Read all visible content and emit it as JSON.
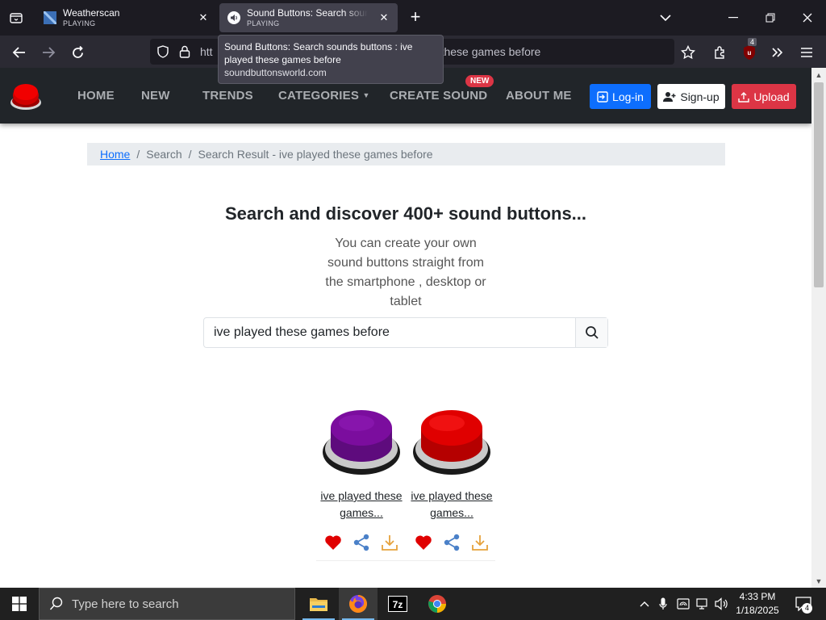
{
  "browser": {
    "tabs": [
      {
        "title": "Weatherscan",
        "status": "PLAYING"
      },
      {
        "title": "Sound Buttons: Search sounds buttons : ive played these games before",
        "status": "PLAYING"
      }
    ],
    "url_visible_start": "htt",
    "url_visible_end": "these games before",
    "extension_badge": "4",
    "tooltip": {
      "title": "Sound Buttons: Search sounds buttons : ive played these games before",
      "host": "soundbuttonsworld.com"
    }
  },
  "site": {
    "nav": [
      "HOME",
      "NEW",
      "TRENDS",
      "CATEGORIES",
      "CREATE SOUND",
      "ABOUT ME"
    ],
    "new_badge": "NEW",
    "login": "Log-in",
    "signup": "Sign-up",
    "upload": "Upload"
  },
  "breadcrumb": {
    "home": "Home",
    "search": "Search",
    "current": "Search Result - ive played these games before"
  },
  "hero": {
    "title": "Search and discover 400+ sound buttons...",
    "description": "You can create your own sound buttons straight from the smartphone , desktop or tablet"
  },
  "search": {
    "value": "ive played these games before"
  },
  "results": [
    {
      "caption": "ive played these games...",
      "color": "#7b0d9e"
    },
    {
      "caption": "ive played these games...",
      "color": "#e00000"
    }
  ],
  "taskbar": {
    "search_placeholder": "Type here to search",
    "time": "4:33 PM",
    "date": "1/18/2025",
    "notification_count": "4"
  },
  "colors": {
    "primary": "#0d6efd",
    "danger": "#dc3545",
    "header_bg": "#212529"
  }
}
